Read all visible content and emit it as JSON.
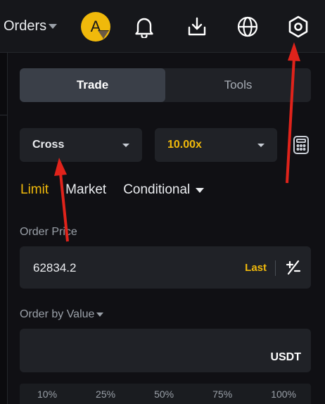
{
  "header": {
    "orders_label": "Orders",
    "avatar_letter": "A",
    "icons": [
      "bell-icon",
      "download-icon",
      "globe-icon",
      "settings-hexagon-icon"
    ]
  },
  "tabs": [
    {
      "label": "Trade",
      "active": true
    },
    {
      "label": "Tools",
      "active": false
    }
  ],
  "margin_mode": {
    "value": "Cross"
  },
  "leverage": {
    "value": "10.00x",
    "color": "#f0b90b"
  },
  "order_types": [
    {
      "label": "Limit",
      "active": true
    },
    {
      "label": "Market",
      "active": false
    },
    {
      "label": "Conditional",
      "active": false,
      "has_dropdown": true
    }
  ],
  "order_price": {
    "label": "Order Price",
    "value": "62834.2",
    "last_label": "Last"
  },
  "order_value": {
    "label": "Order by Value",
    "unit": "USDT"
  },
  "percent_slider": {
    "marks": [
      "10%",
      "25%",
      "50%",
      "75%",
      "100%"
    ]
  },
  "colors": {
    "accent": "#f0b90b",
    "annotation_arrow": "#e0231b",
    "background": "#101014",
    "panel": "#202227"
  }
}
